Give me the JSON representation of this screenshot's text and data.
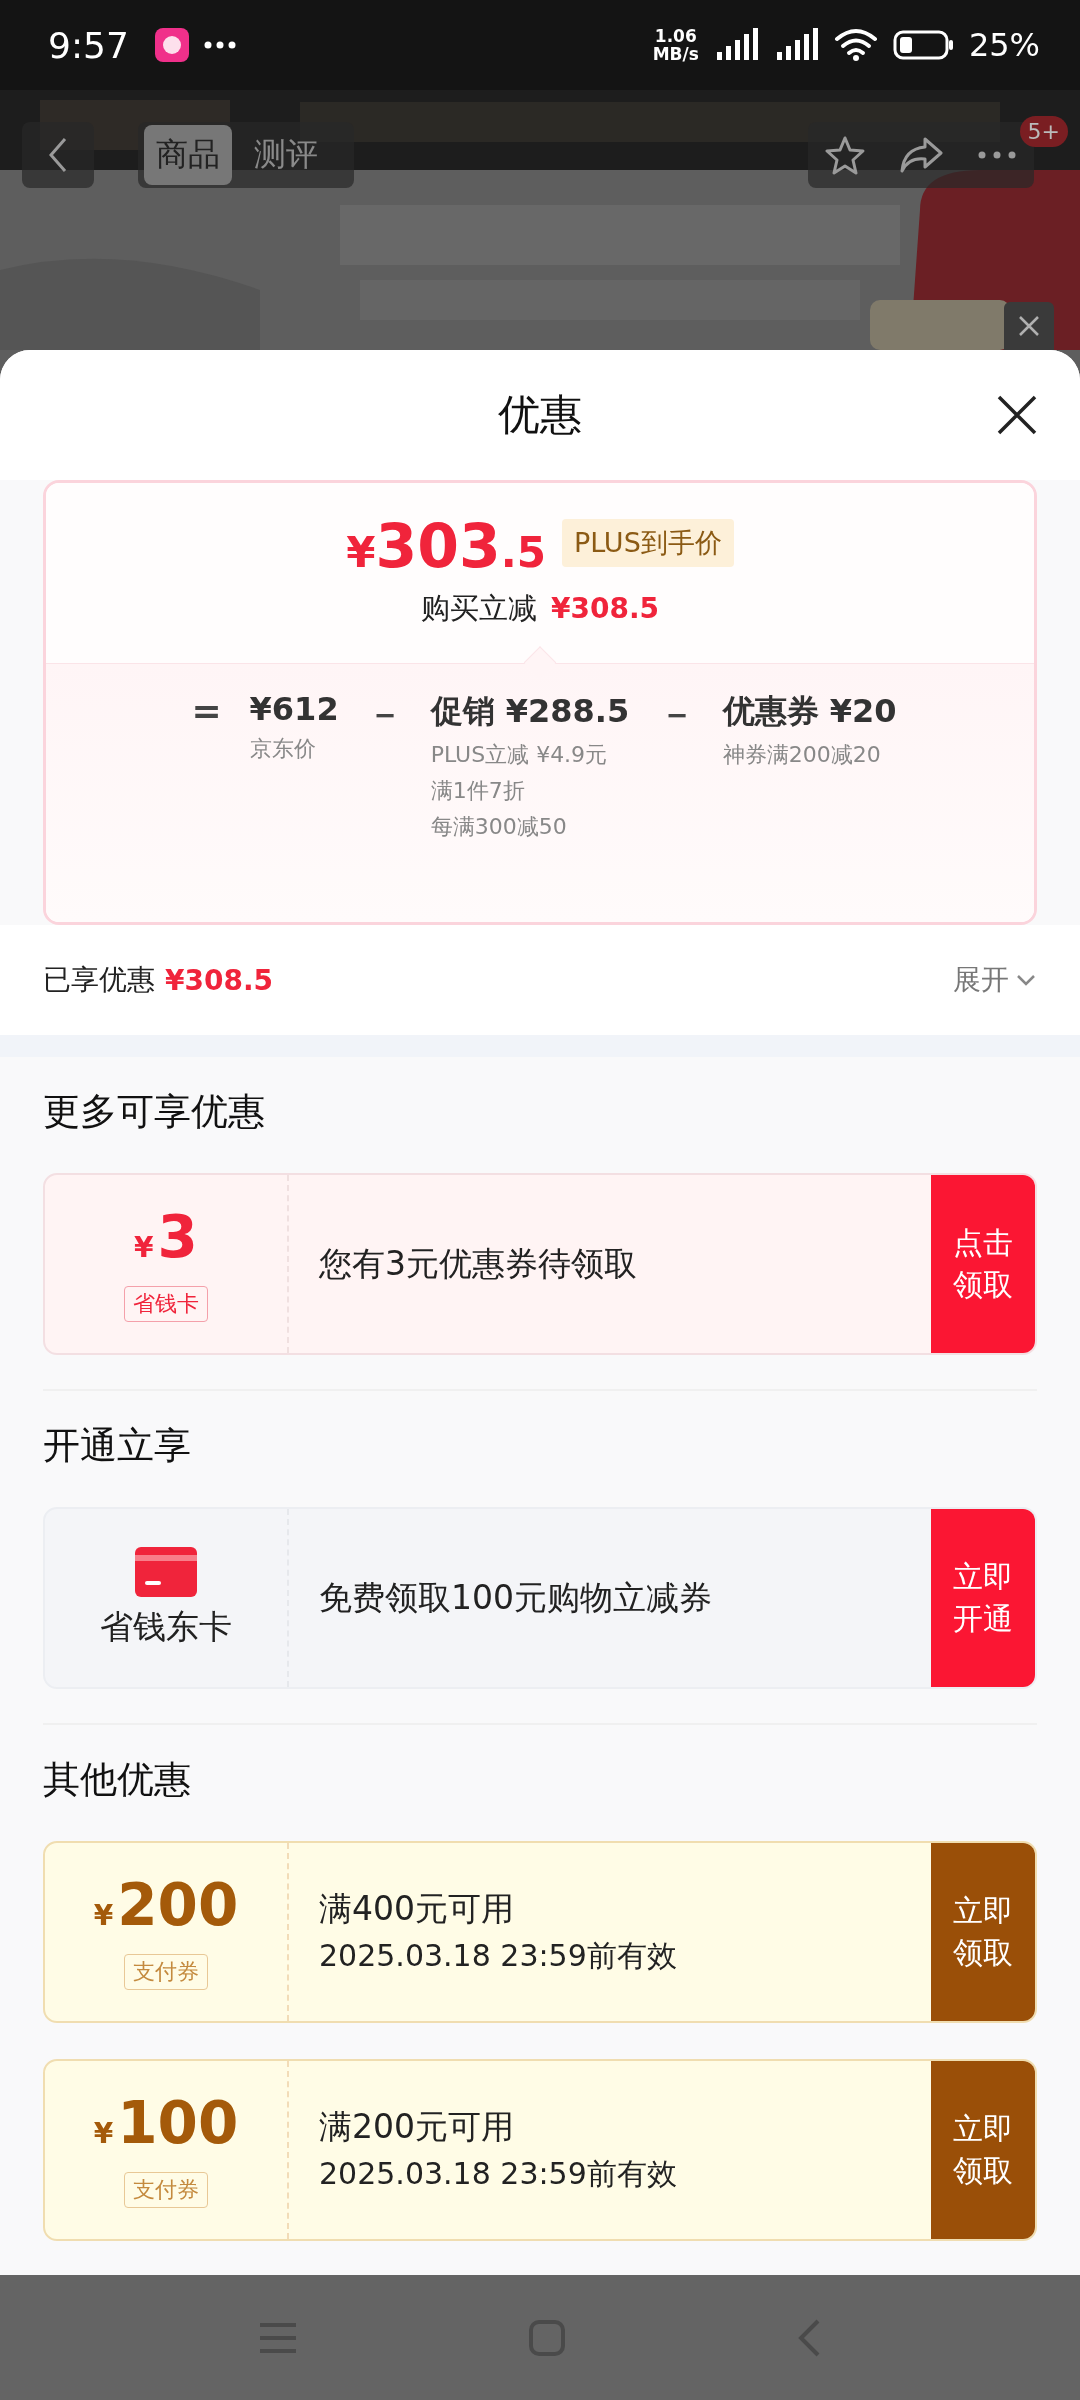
{
  "status_bar": {
    "time": "9:57",
    "net_speed": [
      "1.06",
      "MB/s"
    ],
    "battery": "25%"
  },
  "product_page": {
    "tabs": [
      {
        "label": "商品",
        "selected": true
      },
      {
        "label": "测评",
        "selected": false
      }
    ],
    "badge": "5+"
  },
  "sheet": {
    "title": "优惠",
    "price_card": {
      "currency": "¥",
      "price_int": "303",
      "price_dec": ".5",
      "tag": "PLUS到手价",
      "saving_label": "购买立减",
      "saving_value": "¥308.5",
      "breakdown": [
        {
          "op": "=",
          "amount": "¥612",
          "notes": [
            "京东价"
          ]
        },
        {
          "op": "－",
          "amount": "促销 ¥288.5",
          "notes": [
            "PLUS立减 ¥4.9元",
            "满1件7折",
            "每满300减50"
          ]
        },
        {
          "op": "－",
          "amount": "优惠券 ¥20",
          "notes": [
            "神券满200减20"
          ]
        }
      ]
    },
    "enjoyed": {
      "label": "已享优惠",
      "value": "¥308.5",
      "expand": "展开"
    },
    "sections": [
      {
        "heading": "更多可享优惠",
        "cards": [
          {
            "kind": "coupon",
            "currency": "¥",
            "amount": "3",
            "tag": "省钱卡",
            "lines": [
              "您有3元优惠券待领取"
            ],
            "button": "点击领取"
          }
        ]
      },
      {
        "heading": "开通立享",
        "cards": [
          {
            "kind": "membership",
            "label": "省钱东卡",
            "lines": [
              "免费领取100元购物立减券"
            ],
            "button": "立即开通"
          }
        ]
      },
      {
        "heading": "其他优惠",
        "cards": [
          {
            "kind": "voucher",
            "currency": "¥",
            "amount": "200",
            "tag": "支付券",
            "lines": [
              "满400元可用",
              "2025.03.18 23:59前有效"
            ],
            "button": "立即领取"
          },
          {
            "kind": "voucher",
            "currency": "¥",
            "amount": "100",
            "tag": "支付券",
            "lines": [
              "满200元可用",
              "2025.03.18 23:59前有效"
            ],
            "button": "立即领取"
          }
        ]
      }
    ]
  }
}
